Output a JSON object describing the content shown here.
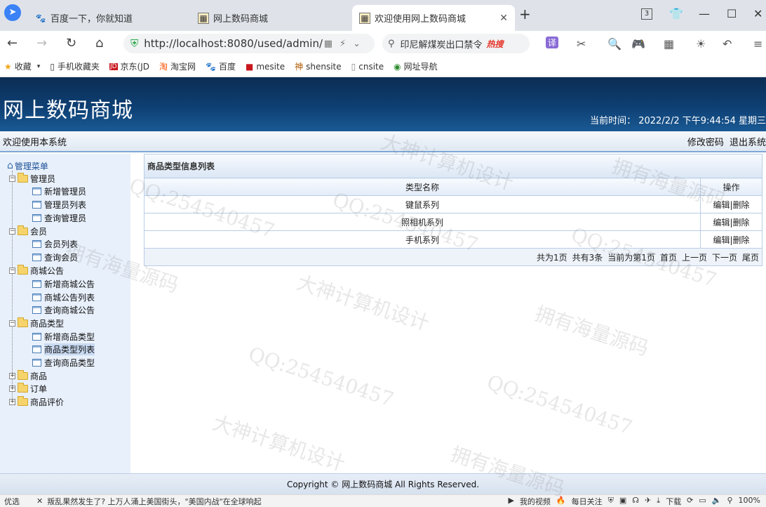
{
  "browser": {
    "tabs": [
      {
        "label": "百度一下，你就知道",
        "active": false
      },
      {
        "label": "网上数码商城",
        "active": false
      },
      {
        "label": "欢迎使用网上数码商城",
        "active": true
      }
    ],
    "tab_count_badge": "3",
    "url": "http://localhost:8080/used/admin/",
    "search_text": "印尼解煤炭出口禁令",
    "search_hot": "热搜",
    "translate_label": "译",
    "bookmarks": [
      {
        "label": "收藏",
        "icon": "star-icon"
      },
      {
        "label": "手机收藏夹",
        "icon": "phone-icon"
      },
      {
        "label": "京东(JD",
        "icon": "jd-icon"
      },
      {
        "label": "淘宝网",
        "icon": "taobao-icon"
      },
      {
        "label": "百度",
        "icon": "baidu-icon"
      },
      {
        "label": "mesite",
        "icon": "mesite-icon"
      },
      {
        "label": "shensite",
        "icon": "shensite-icon"
      },
      {
        "label": "cnsite",
        "icon": "page-icon"
      },
      {
        "label": "网址导航",
        "icon": "nav-icon"
      }
    ]
  },
  "header": {
    "title": "网上数码商城",
    "time_label": "当前时间：",
    "time_value": "2022/2/2 下午9:44:54 星期三"
  },
  "subbar": {
    "welcome": "欢迎使用本系统",
    "change_password": "修改密码",
    "logout": "退出系统"
  },
  "sidebar": {
    "root": "管理菜单",
    "groups": [
      {
        "label": "管理员",
        "expanded": true,
        "items": [
          "新增管理员",
          "管理员列表",
          "查询管理员"
        ]
      },
      {
        "label": "会员",
        "expanded": true,
        "items": [
          "会员列表",
          "查询会员"
        ]
      },
      {
        "label": "商城公告",
        "expanded": true,
        "items": [
          "新增商城公告",
          "商城公告列表",
          "查询商城公告"
        ]
      },
      {
        "label": "商品类型",
        "expanded": true,
        "items": [
          "新增商品类型",
          "商品类型列表",
          "查询商品类型"
        ]
      },
      {
        "label": "商品",
        "expanded": false,
        "items": []
      },
      {
        "label": "订单",
        "expanded": false,
        "items": []
      },
      {
        "label": "商品评价",
        "expanded": false,
        "items": []
      }
    ],
    "selected_item": "商品类型列表"
  },
  "panel": {
    "title": "商品类型信息列表",
    "columns": [
      "类型名称",
      "操作"
    ],
    "rows": [
      {
        "name": "键鼠系列",
        "edit": "编辑",
        "sep": "|",
        "delete": "删除"
      },
      {
        "name": "照相机系列",
        "edit": "编辑",
        "sep": "|",
        "delete": "删除"
      },
      {
        "name": "手机系列",
        "edit": "编辑",
        "sep": "|",
        "delete": "删除"
      }
    ],
    "pager": {
      "total_pages": "共为1页",
      "total_records": "共有3条",
      "current": "当前为第1页",
      "first": "首页",
      "prev": "上一页",
      "next": "下一页",
      "last": "尾页"
    }
  },
  "footer": {
    "copyright": "Copyright © 网上数码商城 All Rights Reserved."
  },
  "statusbar": {
    "left": "优选",
    "news": "叛乱果然发生了? 上万人涌上美国街头，\"美国内战\"在全球响起",
    "my_video": "我的视频",
    "daily": "每日关注",
    "download": "下载",
    "zoom": "100%"
  },
  "watermark": {
    "texts": [
      "QQ:254540457",
      "大神计算机设计",
      "拥有海量源码"
    ]
  }
}
